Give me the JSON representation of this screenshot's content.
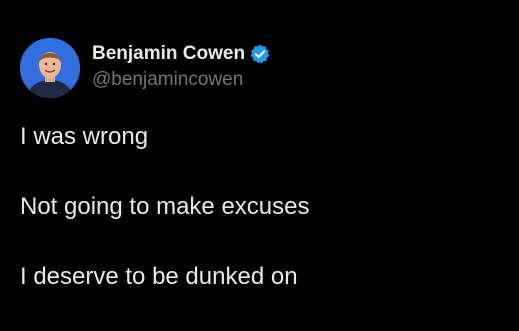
{
  "author": {
    "display_name": "Benjamin Cowen",
    "handle": "@benjamincowen",
    "verified": true,
    "avatar_icon": "profile-photo",
    "verified_icon": "verified-badge-icon"
  },
  "tweet": {
    "lines": [
      "I was wrong",
      "Not going to make excuses",
      "I deserve to be dunked on"
    ]
  },
  "colors": {
    "background": "#000000",
    "text_primary": "#e7e9ea",
    "text_secondary": "#71767b",
    "verified_blue": "#1d9bf0",
    "avatar_background": "#2f6fe0"
  }
}
